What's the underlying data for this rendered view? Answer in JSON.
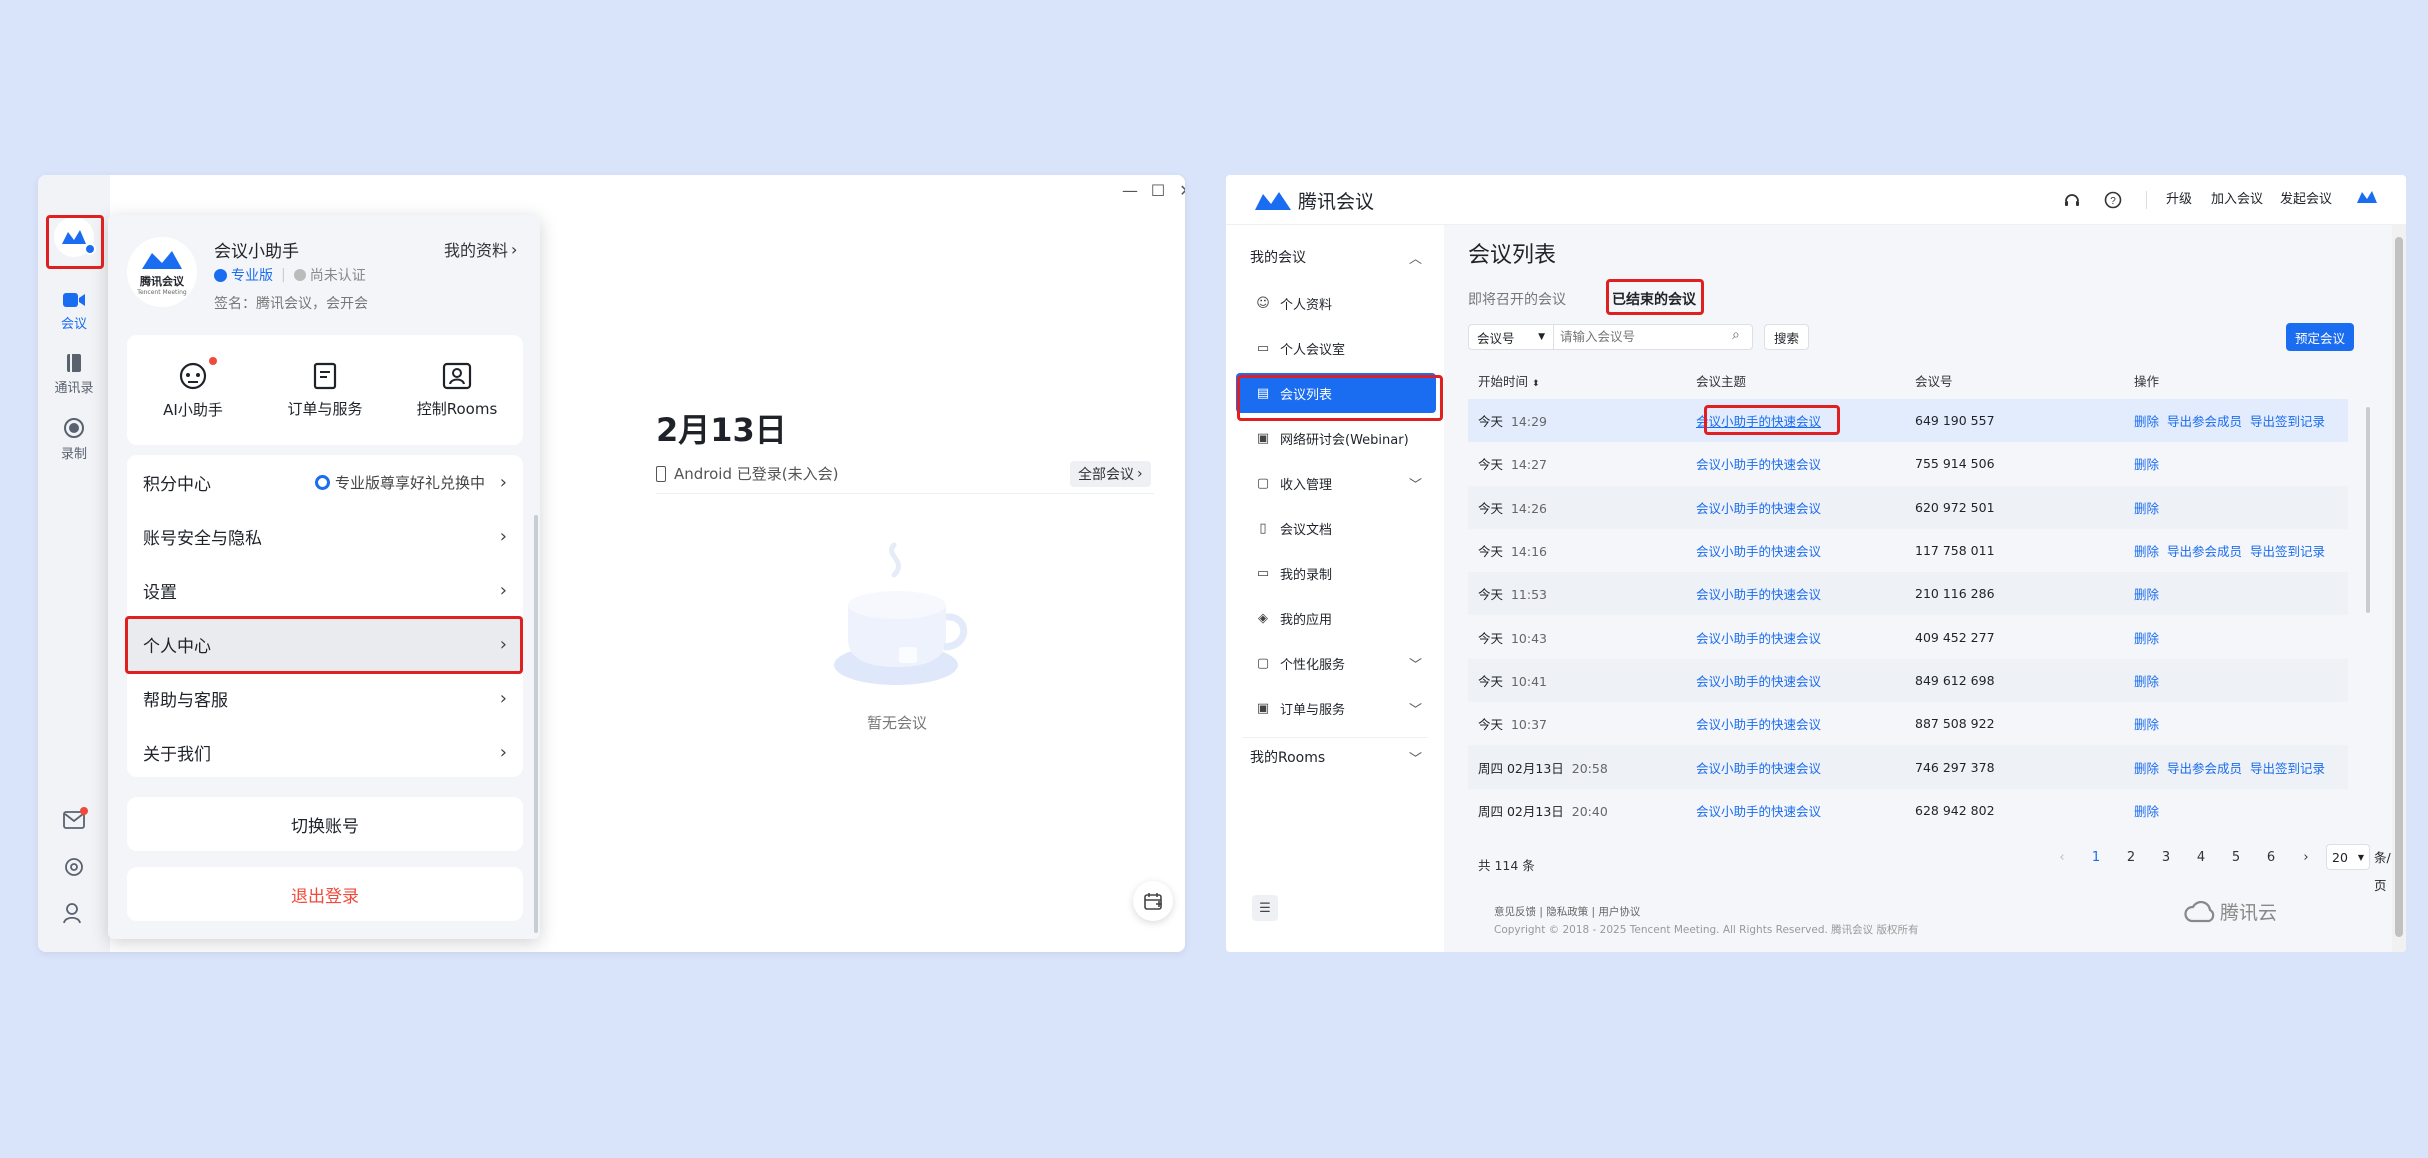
{
  "left": {
    "rail": {
      "meeting": "会议",
      "contacts": "通讯录",
      "record": "录制"
    },
    "popup": {
      "name": "会议小助手",
      "profile_link": "我的资料",
      "tier": "专业版",
      "verify": "尚未认证",
      "signature": "签名：腾讯会议，会开会",
      "avatar_text_cn": "腾讯会议",
      "avatar_text_en": "Tencent Meeting",
      "quick": [
        "AI小助手",
        "订单与服务",
        "控制Rooms"
      ],
      "points": "积分中心",
      "points_promo": "专业版尊享好礼兑换中",
      "menu": [
        "账号安全与隐私",
        "设置",
        "个人中心",
        "帮助与客服",
        "关于我们"
      ],
      "switch": "切换账号",
      "logout": "退出登录"
    },
    "main": {
      "date": "2月13日",
      "device": "Android 已登录(未入会)",
      "all_meetings": "全部会议",
      "empty": "暂无会议"
    }
  },
  "right": {
    "brand": "腾讯会议",
    "nav": [
      "升级",
      "加入会议",
      "发起会议"
    ],
    "side": {
      "my_meetings": "我的会议",
      "items": [
        "个人资料",
        "个人会议室",
        "会议列表",
        "网络研讨会(Webinar)",
        "收入管理",
        "会议文档",
        "我的录制",
        "我的应用",
        "个性化服务",
        "订单与服务"
      ],
      "rooms": "我的Rooms"
    },
    "page_title": "会议列表",
    "tabs": [
      "即将召开的会议",
      "已结束的会议"
    ],
    "filter": {
      "select": "会议号",
      "placeholder": "请输入会议号",
      "search": "搜索",
      "book": "预定会议"
    },
    "columns": [
      "开始时间",
      "会议主题",
      "会议号",
      "操作"
    ],
    "rows": [
      {
        "day": "今天",
        "time": "14:29",
        "topic": "会议小助手的快速会议",
        "id": "649 190 557",
        "extra": true
      },
      {
        "day": "今天",
        "time": "14:27",
        "topic": "会议小助手的快速会议",
        "id": "755 914 506",
        "extra": false
      },
      {
        "day": "今天",
        "time": "14:26",
        "topic": "会议小助手的快速会议",
        "id": "620 972 501",
        "extra": false
      },
      {
        "day": "今天",
        "time": "14:16",
        "topic": "会议小助手的快速会议",
        "id": "117 758 011",
        "extra": true
      },
      {
        "day": "今天",
        "time": "11:53",
        "topic": "会议小助手的快速会议",
        "id": "210 116 286",
        "extra": false
      },
      {
        "day": "今天",
        "time": "10:43",
        "topic": "会议小助手的快速会议",
        "id": "409 452 277",
        "extra": false
      },
      {
        "day": "今天",
        "time": "10:41",
        "topic": "会议小助手的快速会议",
        "id": "849 612 698",
        "extra": false
      },
      {
        "day": "今天",
        "time": "10:37",
        "topic": "会议小助手的快速会议",
        "id": "887 508 922",
        "extra": false
      },
      {
        "day": "周四 02月13日",
        "time": "20:58",
        "topic": "会议小助手的快速会议",
        "id": "746 297 378",
        "extra": true
      },
      {
        "day": "周四 02月13日",
        "time": "20:40",
        "topic": "会议小助手的快速会议",
        "id": "628 942 802",
        "extra": false
      }
    ],
    "actions": {
      "delete": "删除",
      "export_members": "导出参会成员",
      "export_signin": "导出签到记录"
    },
    "total": "共 114 条",
    "pages": [
      "1",
      "2",
      "3",
      "4",
      "5",
      "6"
    ],
    "page_size": "20",
    "per_page": "条/页",
    "footer_links": "意见反馈 | 隐私政策 | 用户协议",
    "copyright": "Copyright © 2018 - 2025 Tencent Meeting. All Rights Reserved. 腾讯会议 版权所有",
    "cloud_logo": "腾讯云"
  }
}
